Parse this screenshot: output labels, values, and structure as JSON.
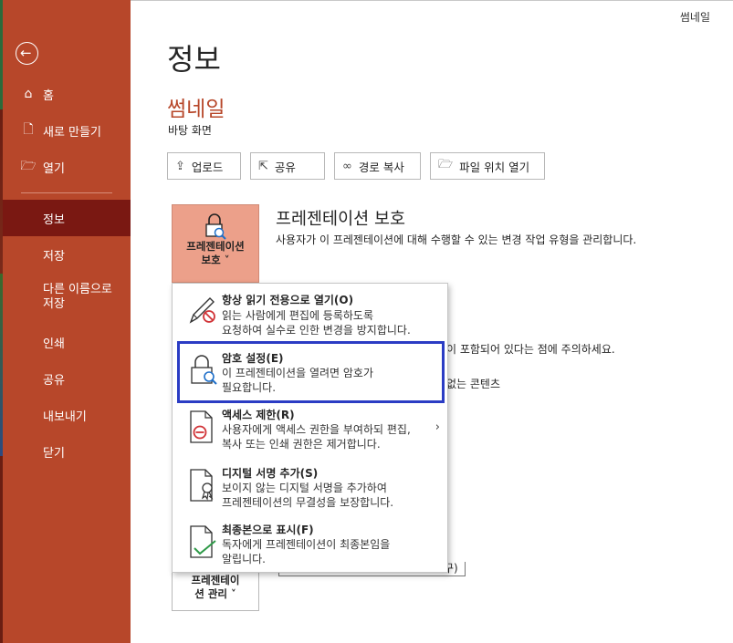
{
  "account": {
    "name": "썸네일"
  },
  "sidebar": {
    "back_icon": "back-arrow-icon",
    "items": [
      {
        "label": "홈",
        "icon": "home-icon"
      },
      {
        "label": "새로 만들기",
        "icon": "new-file-icon"
      },
      {
        "label": "열기",
        "icon": "open-folder-icon"
      },
      {
        "label": "정보"
      },
      {
        "label": "저장"
      },
      {
        "label": "다른 이름으로\n저장"
      },
      {
        "label": "인쇄"
      },
      {
        "label": "공유"
      },
      {
        "label": "내보내기"
      },
      {
        "label": "닫기"
      }
    ],
    "active_item": "정보",
    "colors": {
      "background": "#b7472a",
      "active": "#7a1812"
    }
  },
  "main": {
    "title": "정보",
    "file_name": "썸네일",
    "file_location": "바탕 화면",
    "actions": [
      {
        "label": "업로드",
        "icon": "upload-icon"
      },
      {
        "label": "공유",
        "icon": "share-icon"
      },
      {
        "label": "경로 복사",
        "icon": "link-icon"
      },
      {
        "label": "파일 위치 열기",
        "icon": "folder-icon"
      }
    ],
    "protect": {
      "tile_label_line1": "프레젠테이션",
      "tile_label_line2": "보호 ˅",
      "title": "프레젠테이션 보호",
      "description": "사용자가 이 프레젠테이션에 대해 수행할 수 있는 변경 작업 유형을 관리합니다."
    },
    "partial_text": {
      "line1": "이 포함되어 있다는 점에 주의하세요.",
      "line2": "없는 콘텐츠",
      "line3": "구)"
    },
    "manage": {
      "tile_label_line1": "프레젠테이",
      "tile_label_line2": "션 관리 ˅"
    }
  },
  "menu": {
    "items": [
      {
        "title": "항상 읽기 전용으로 열기(O)",
        "desc": "읽는 사람에게 편집에 등록하도록\n요청하여 실수로 인한 변경을 방지합니다.",
        "icon": "pencil-readonly-icon"
      },
      {
        "title": "암호 설정(E)",
        "desc": "이 프레젠테이션을 열려면 암호가\n필요합니다.",
        "icon": "lock-search-icon",
        "highlighted": true
      },
      {
        "title": "액세스 제한(R)",
        "desc": "사용자에게 액세스 권한을 부여하되 편집,\n복사 또는 인쇄 권한은 제거합니다.",
        "icon": "restrict-document-icon",
        "has_submenu": true
      },
      {
        "title": "디지털 서명 추가(S)",
        "desc": "보이지 않는 디지털 서명을 추가하여\n프레젠테이션의 무결성을 보장합니다.",
        "icon": "signature-document-icon"
      },
      {
        "title": "최종본으로 표시(F)",
        "desc": "독자에게 프레젠테이션이 최종본임을\n알립니다.",
        "icon": "final-document-icon"
      }
    ],
    "highlight_color": "#2b3cc4"
  }
}
